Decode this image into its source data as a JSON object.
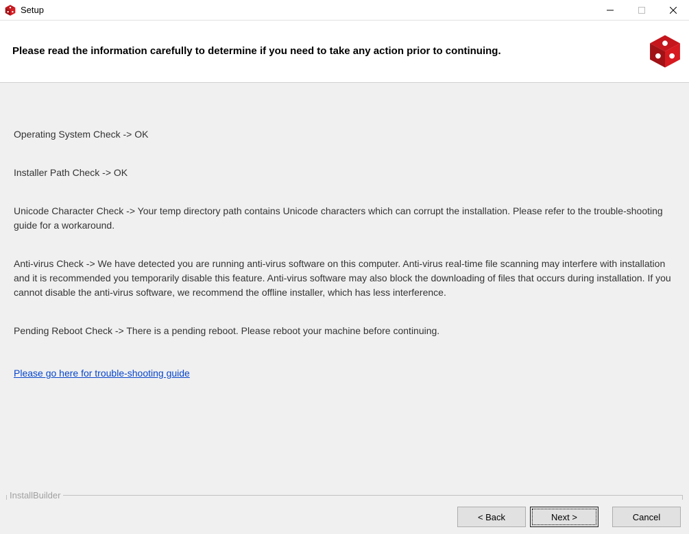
{
  "titlebar": {
    "title": "Setup"
  },
  "header": {
    "instruction": "Please read the information carefully to determine if you need to take any action prior to continuing."
  },
  "checks": {
    "os": "Operating System Check -> OK",
    "path": "Installer Path Check -> OK",
    "unicode": "Unicode Character Check ->  Your temp directory path contains Unicode characters which can corrupt the installation. Please refer to the trouble-shooting guide for a workaround.",
    "antivirus": "Anti-virus Check -> We have detected you are running anti-virus software on this computer. Anti-virus real-time file scanning may interfere with installation and it is recommended you temporarily disable this feature. Anti-virus software may also block the downloading of files that occurs during installation. If you cannot disable the anti-virus software, we recommend the offline installer, which has less interference.",
    "reboot": "Pending Reboot Check -> There is a pending reboot. Please reboot your machine before continuing."
  },
  "link_text": "Please go here for trouble-shooting guide",
  "builder_label": "InstallBuilder",
  "footer": {
    "back": "< Back",
    "next": "Next >",
    "cancel": "Cancel"
  },
  "colors": {
    "brand_red": "#c4161c"
  }
}
